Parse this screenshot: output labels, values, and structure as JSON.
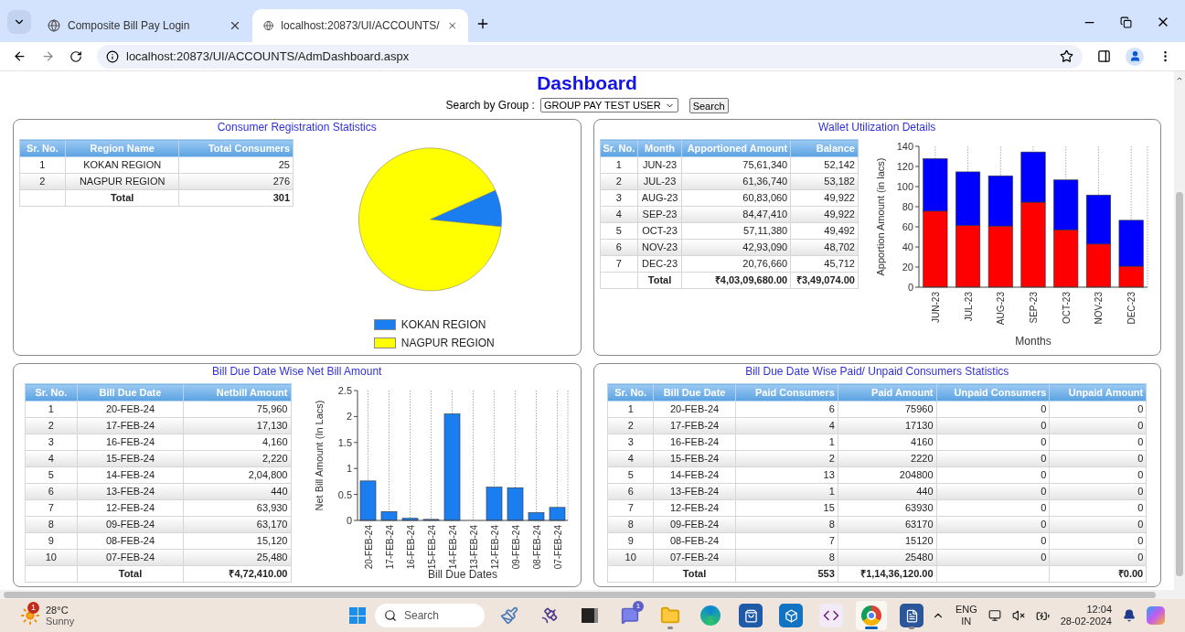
{
  "browser": {
    "tabs": [
      {
        "title": "Composite Bill Pay Login",
        "selected": false
      },
      {
        "title": "localhost:20873/UI/ACCOUNTS/",
        "selected": true
      }
    ],
    "url": "localhost:20873/UI/ACCOUNTS/AdmDashboard.aspx"
  },
  "page": {
    "title": "Dashboard",
    "search": {
      "label": "Search by Group :",
      "value": "GROUP PAY TEST USER",
      "button": "Search"
    }
  },
  "panels": [
    {
      "title": "Consumer Registration Statistics",
      "table": {
        "columns": [
          {
            "label": "Sr. No.",
            "kind": "index"
          },
          {
            "label": "Region Name",
            "kind": "label"
          },
          {
            "label": "Total Consumers",
            "kind": "amount"
          }
        ],
        "rows": [
          [
            "1",
            "KOKAN REGION",
            "25"
          ],
          [
            "2",
            "NAGPUR REGION",
            "276"
          ]
        ],
        "total": [
          {
            "kind": "blank"
          },
          {
            "kind": "label",
            "text": "Total"
          },
          {
            "kind": "amount",
            "text": "301"
          }
        ]
      },
      "chart_data": {
        "type": "pie",
        "categories": [
          "KOKAN REGION",
          "NAGPUR REGION"
        ],
        "values": [
          8.3,
          91.7
        ],
        "colors": [
          "#1a7ef0",
          "#ffff00"
        ],
        "legend": "bottom"
      }
    },
    {
      "title": "Wallet Utilization Details",
      "table": {
        "columns": [
          {
            "label": "Sr. No.",
            "kind": "index"
          },
          {
            "label": "Month",
            "kind": "label"
          },
          {
            "label": "Apportioned Amount",
            "kind": "amount"
          },
          {
            "label": "Balance",
            "kind": "amount"
          }
        ],
        "rows": [
          [
            "1",
            "JUN-23",
            "75,61,340",
            "52,142"
          ],
          [
            "2",
            "JUL-23",
            "61,36,740",
            "53,182"
          ],
          [
            "3",
            "AUG-23",
            "60,83,060",
            "49,922"
          ],
          [
            "4",
            "SEP-23",
            "84,47,410",
            "49,922"
          ],
          [
            "5",
            "OCT-23",
            "57,11,380",
            "49,492"
          ],
          [
            "6",
            "NOV-23",
            "42,93,090",
            "48,702"
          ],
          [
            "7",
            "DEC-23",
            "20,76,660",
            "45,712"
          ]
        ],
        "total": [
          {
            "kind": "blank"
          },
          {
            "kind": "label",
            "text": "Total"
          },
          {
            "kind": "amount",
            "text": "₹4,03,09,680.00"
          },
          {
            "kind": "amount",
            "text": "₹3,49,074.00"
          }
        ]
      },
      "chart_data": {
        "type": "bar",
        "stacked": true,
        "grid": true,
        "xlabel": "Months",
        "ylabel": "Apportion Amount (in lacs)",
        "categories": [
          "JUN-23",
          "JUL-23",
          "AUG-23",
          "SEP-23",
          "OCT-23",
          "NOV-23",
          "DEC-23"
        ],
        "series": [
          {
            "color": "#ff0000",
            "values": [
              75.6,
              61.4,
              60.8,
              84.5,
              57.1,
              42.9,
              20.8
            ]
          },
          {
            "color": "#0000ff",
            "values": [
              52.1,
              53.2,
              49.9,
              49.9,
              49.5,
              48.7,
              45.7
            ]
          }
        ],
        "ylim": [
          0,
          140
        ],
        "yticks": [
          0,
          20,
          40,
          60,
          80,
          100,
          120,
          140
        ]
      }
    },
    {
      "title": "Bill Due Date Wise Net Bill Amount",
      "table": {
        "columns": [
          {
            "label": "Sr. No.",
            "kind": "index"
          },
          {
            "label": "Bill Due Date",
            "kind": "label"
          },
          {
            "label": "Netbill Amount",
            "kind": "amount"
          }
        ],
        "rows": [
          [
            "1",
            "20-FEB-24",
            "75,960"
          ],
          [
            "2",
            "17-FEB-24",
            "17,130"
          ],
          [
            "3",
            "16-FEB-24",
            "4,160"
          ],
          [
            "4",
            "15-FEB-24",
            "2,220"
          ],
          [
            "5",
            "14-FEB-24",
            "2,04,800"
          ],
          [
            "6",
            "13-FEB-24",
            "440"
          ],
          [
            "7",
            "12-FEB-24",
            "63,930"
          ],
          [
            "8",
            "09-FEB-24",
            "63,170"
          ],
          [
            "9",
            "08-FEB-24",
            "15,120"
          ],
          [
            "10",
            "07-FEB-24",
            "25,480"
          ]
        ],
        "total": [
          {
            "kind": "blank"
          },
          {
            "kind": "label",
            "text": "Total"
          },
          {
            "kind": "amount",
            "text": "₹4,72,410.00"
          }
        ]
      },
      "chart_data": {
        "type": "bar",
        "grid": true,
        "xlabel": "Bill Due Dates",
        "ylabel": "Net Bill Amount (In Lacs)",
        "categories": [
          "20-FEB-24",
          "17-FEB-24",
          "16-FEB-24",
          "15-FEB-24",
          "14-FEB-24",
          "13-FEB-24",
          "12-FEB-24",
          "09-FEB-24",
          "08-FEB-24",
          "07-FEB-24"
        ],
        "series": [
          {
            "color": "#1a7ef0",
            "values": [
              0.76,
              0.17,
              0.04,
              0.02,
              2.05,
              0.0,
              0.64,
              0.63,
              0.15,
              0.25
            ]
          }
        ],
        "ylim": [
          0,
          2.5
        ],
        "yticks": [
          0,
          0.5,
          1,
          1.5,
          2,
          2.5
        ]
      }
    },
    {
      "title": "Bill Due Date Wise Paid/ Unpaid Consumers Statistics",
      "table": {
        "columns": [
          {
            "label": "Sr. No.",
            "kind": "index"
          },
          {
            "label": "Bill Due Date",
            "kind": "label"
          },
          {
            "label": "Paid Consumers",
            "kind": "amount"
          },
          {
            "label": "Paid Amount",
            "kind": "amount"
          },
          {
            "label": "Unpaid Consumers",
            "kind": "amount"
          },
          {
            "label": "Unpaid Amount",
            "kind": "amount"
          }
        ],
        "rows": [
          [
            "1",
            "20-FEB-24",
            "6",
            "75960",
            "0",
            "0"
          ],
          [
            "2",
            "17-FEB-24",
            "4",
            "17130",
            "0",
            "0"
          ],
          [
            "3",
            "16-FEB-24",
            "1",
            "4160",
            "0",
            "0"
          ],
          [
            "4",
            "15-FEB-24",
            "2",
            "2220",
            "0",
            "0"
          ],
          [
            "5",
            "14-FEB-24",
            "13",
            "204800",
            "0",
            "0"
          ],
          [
            "6",
            "13-FEB-24",
            "1",
            "440",
            "0",
            "0"
          ],
          [
            "7",
            "12-FEB-24",
            "15",
            "63930",
            "0",
            "0"
          ],
          [
            "8",
            "09-FEB-24",
            "8",
            "63170",
            "0",
            "0"
          ],
          [
            "9",
            "08-FEB-24",
            "7",
            "15120",
            "0",
            "0"
          ],
          [
            "10",
            "07-FEB-24",
            "8",
            "25480",
            "0",
            "0"
          ]
        ],
        "total": [
          {
            "kind": "blank"
          },
          {
            "kind": "label",
            "text": "Total"
          },
          {
            "kind": "amount",
            "text": "553"
          },
          {
            "kind": "amount",
            "text": "₹1,14,36,120.00"
          },
          {
            "kind": "blank"
          },
          {
            "kind": "amount",
            "text": "₹0.00"
          }
        ]
      }
    }
  ],
  "taskbar": {
    "weather": {
      "badge": "1",
      "temperature": "28°C",
      "condition": "Sunny"
    },
    "search_placeholder": "Search",
    "apps": [
      {
        "kind": "paint",
        "selected": false,
        "running": false
      },
      {
        "kind": "satellite",
        "selected": false,
        "running": false
      },
      {
        "kind": "taskview",
        "selected": false,
        "running": false
      },
      {
        "kind": "chat",
        "selected": false,
        "running": false,
        "badge": "1"
      },
      {
        "kind": "folder",
        "selected": false,
        "running": true
      },
      {
        "kind": "edge",
        "selected": false,
        "running": false
      },
      {
        "kind": "store",
        "selected": false,
        "running": false
      },
      {
        "kind": "cube",
        "selected": false,
        "running": false
      },
      {
        "kind": "studio",
        "selected": false,
        "running": false
      },
      {
        "kind": "chrome",
        "selected": true,
        "running": true
      },
      {
        "kind": "word",
        "selected": false,
        "running": true
      }
    ],
    "language": "ENG",
    "region": "IN",
    "time": "12:04",
    "date": "28-02-2024"
  }
}
